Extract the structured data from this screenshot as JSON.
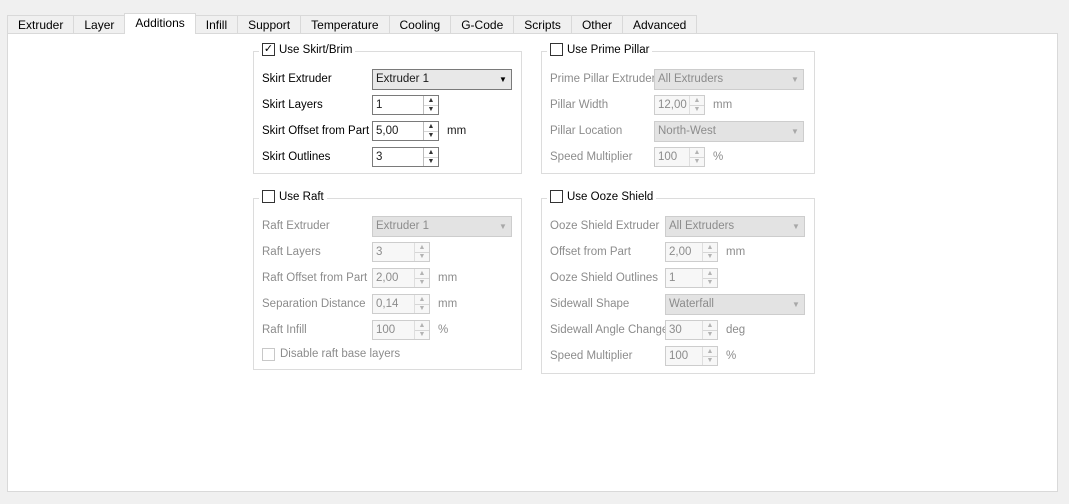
{
  "tabs": [
    "Extruder",
    "Layer",
    "Additions",
    "Infill",
    "Support",
    "Temperature",
    "Cooling",
    "G-Code",
    "Scripts",
    "Other",
    "Advanced"
  ],
  "active_tab": "Additions",
  "skirt": {
    "title": "Use Skirt/Brim",
    "checked": true,
    "extruder_label": "Skirt Extruder",
    "extruder_value": "Extruder 1",
    "layers_label": "Skirt Layers",
    "layers_value": "1",
    "offset_label": "Skirt Offset from Part",
    "offset_value": "5,00",
    "offset_unit": "mm",
    "outlines_label": "Skirt Outlines",
    "outlines_value": "3"
  },
  "raft": {
    "title": "Use Raft",
    "checked": false,
    "extruder_label": "Raft Extruder",
    "extruder_value": "Extruder 1",
    "layers_label": "Raft Layers",
    "layers_value": "3",
    "offset_label": "Raft Offset from Part",
    "offset_value": "2,00",
    "offset_unit": "mm",
    "separation_label": "Separation Distance",
    "separation_value": "0,14",
    "separation_unit": "mm",
    "infill_label": "Raft Infill",
    "infill_value": "100",
    "infill_unit": "%",
    "disable_base_label": "Disable raft base layers"
  },
  "prime_pillar": {
    "title": "Use Prime Pillar",
    "checked": false,
    "extruder_label": "Prime Pillar Extruder",
    "extruder_value": "All Extruders",
    "width_label": "Pillar Width",
    "width_value": "12,00",
    "width_unit": "mm",
    "location_label": "Pillar Location",
    "location_value": "North-West",
    "speed_label": "Speed Multiplier",
    "speed_value": "100",
    "speed_unit": "%"
  },
  "ooze_shield": {
    "title": "Use Ooze Shield",
    "checked": false,
    "extruder_label": "Ooze Shield Extruder",
    "extruder_value": "All Extruders",
    "offset_label": "Offset from Part",
    "offset_value": "2,00",
    "offset_unit": "mm",
    "outlines_label": "Ooze Shield Outlines",
    "outlines_value": "1",
    "sidewall_label": "Sidewall Shape",
    "sidewall_value": "Waterfall",
    "angle_label": "Sidewall Angle Change",
    "angle_value": "30",
    "angle_unit": "deg",
    "speed_label": "Speed Multiplier",
    "speed_value": "100",
    "speed_unit": "%"
  },
  "icons": {
    "check": "✓",
    "spin_up": "▲",
    "spin_down": "▼",
    "dropdown": "▼"
  }
}
